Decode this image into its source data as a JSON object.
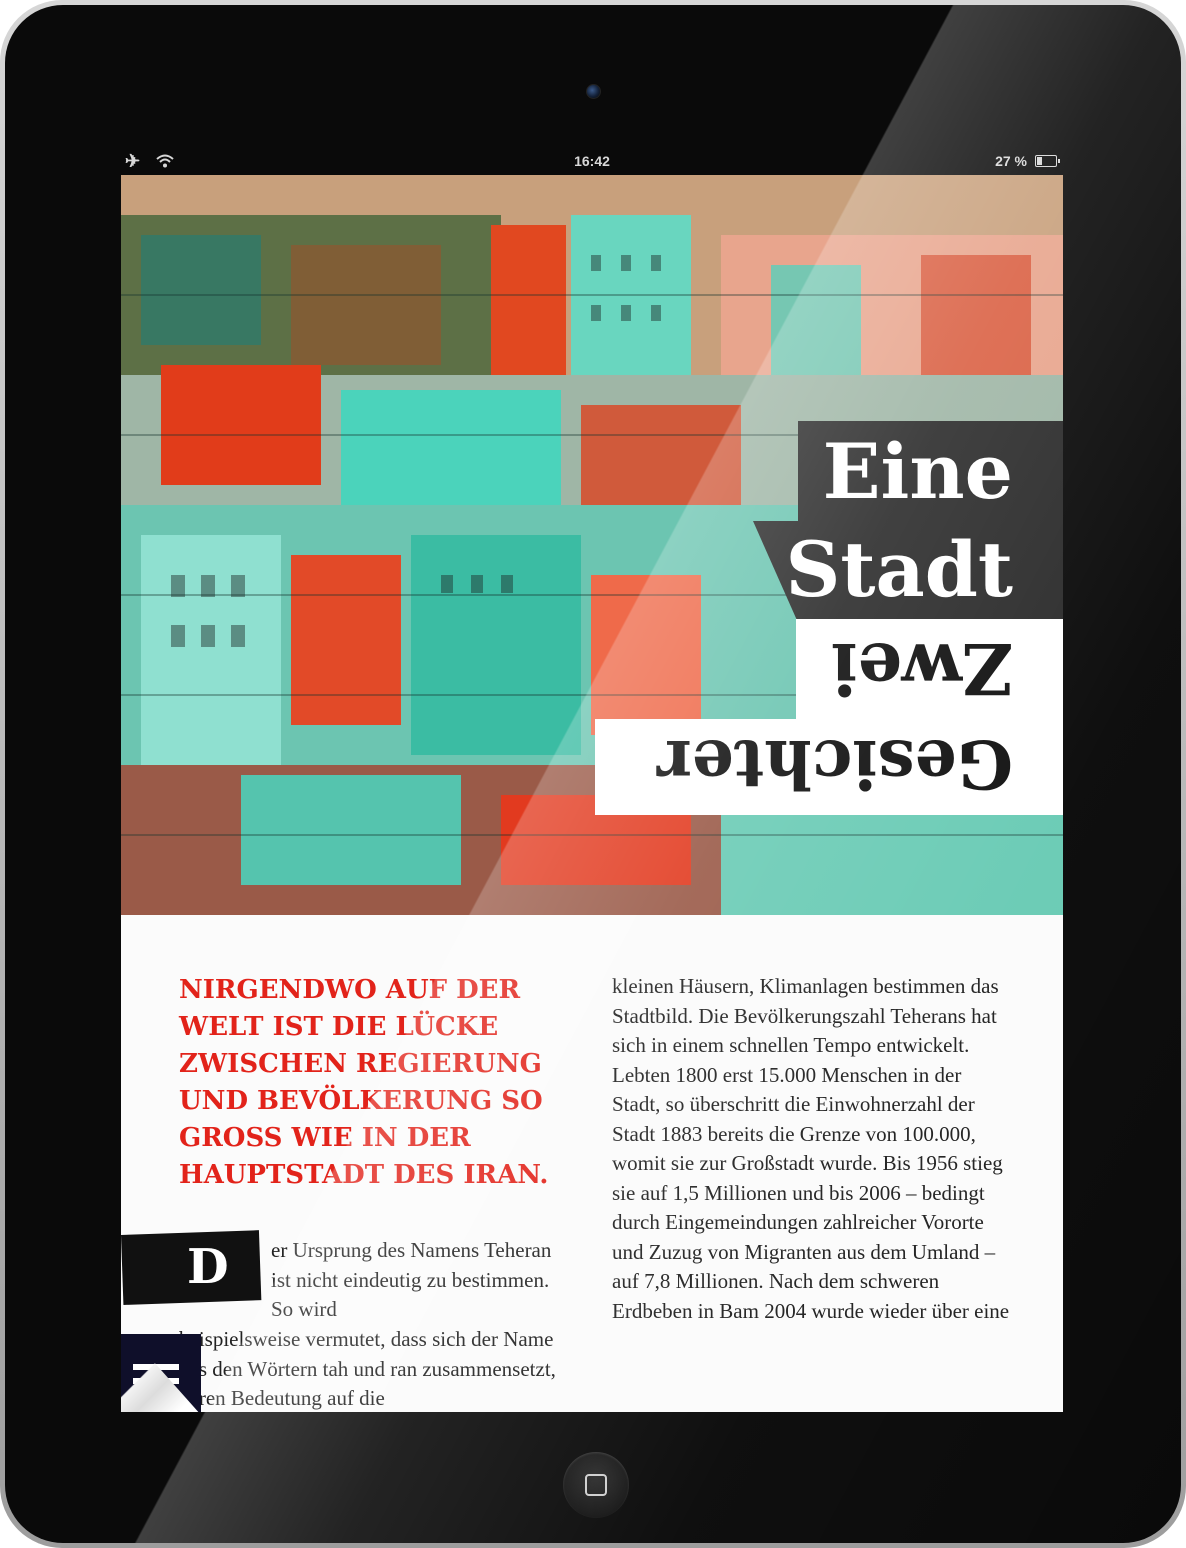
{
  "status_bar": {
    "time": "16:42",
    "battery_percent": "27 %",
    "battery_level": 0.27,
    "airplane_icon": "airplane-icon",
    "wifi_icon": "wifi-icon"
  },
  "article": {
    "title_line1": "Eine",
    "title_line2": "Stadt",
    "title_line3": "Zwei",
    "title_line4": "Gesichter",
    "lead": "NiRGENDWO AUF DER WELT iST DiE LüCKE ZWiSCHEN REGiERUNG UND BEVöLKERUNG SO GROSS WiE iN DER HAUPTSTADT DES IRAN.",
    "drop_cap": "D",
    "body_left_part1": "er Ursprung des Namens Teheran ist nicht eindeutig zu bestimmen. So wird",
    "body_left_part2": "beispielsweise vermutet, dass sich der Name aus den Wörtern tah und ran zusammensetzt, deren Bedeutung auf die",
    "body_right": "kleinen Häusern, Klimanlagen bestimmen das Stadtbild. Die Bevölkerungszahl Teherans hat sich in einem schnellen Tempo entwickelt. Lebten 1800 erst 15.000 Menschen in der Stadt, so überschritt die Einwohnerzahl der Stadt 1883 bereits die Grenze von 100.000, womit sie zur Großstadt wurde. Bis 1956 stieg sie auf 1,5 Millionen und bis 2006 – bedingt durch Eingemeindungen zahlreicher Vororte und Zuzug von Migranten aus dem Umland – auf 7,8 Millionen. Nach dem schweren Erdbeben in Bam 2004 wurde wieder über eine"
  },
  "ui": {
    "menu_icon": "menu-icon",
    "page_curl_icon": "page-curl-icon",
    "home_button_icon": "home-button-icon"
  },
  "colors": {
    "lead_red": "#e2231a",
    "title_dark": "#2b2b2b",
    "menu_navy": "#0f0f2a"
  }
}
